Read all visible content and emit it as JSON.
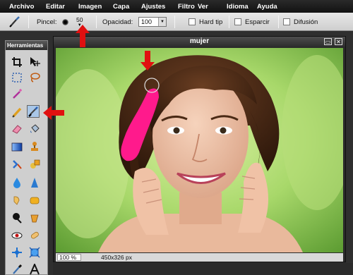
{
  "menu": [
    "Archivo",
    "Editar",
    "Imagen",
    "Capa",
    "Ajustes",
    "Filtro",
    "Ver",
    "Idioma",
    "Ayuda"
  ],
  "options": {
    "brush_label": "Pincel:",
    "brush_size": "50",
    "opacity_label": "Opacidad:",
    "opacity_value": "100",
    "hard_tip_label": "Hard tip",
    "scatter_label": "Esparcir",
    "diffusion_label": "Difusión"
  },
  "tools_panel": {
    "title": "Herramientas"
  },
  "document": {
    "title": "mujer",
    "zoom": "100 %",
    "dimensions": "450x326 px"
  },
  "colors": {
    "annotation_red": "#e01010",
    "brush_stroke": "#ff1a8c",
    "menu_bg": "#1b1b1b"
  }
}
